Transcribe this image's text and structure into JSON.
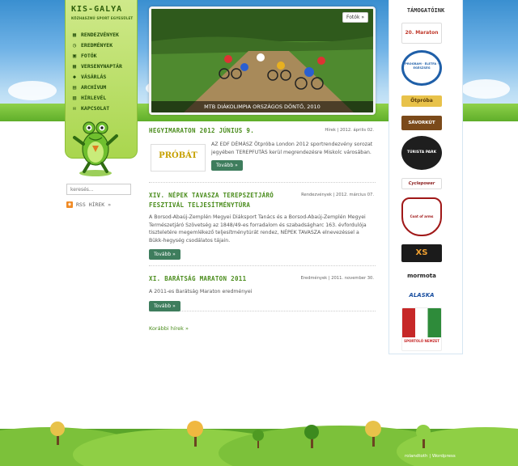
{
  "site": {
    "title": "KIS-GALYA",
    "subtitle": "KÖZHASZNÚ SPORT EGYESÜLET"
  },
  "nav": {
    "items": [
      {
        "label": "RENDEZVÉNYEK",
        "icon": "calendar-icon"
      },
      {
        "label": "EREDMÉNYEK",
        "icon": "clock-icon"
      },
      {
        "label": "FOTÓK",
        "icon": "photos-icon"
      },
      {
        "label": "VERSENYNAPTÁR",
        "icon": "calendar-icon"
      },
      {
        "label": "VÁSÁRLÁS",
        "icon": "tag-icon"
      },
      {
        "label": "ARCHÍVUM",
        "icon": "archive-icon"
      },
      {
        "label": "HÍRLEVÉL",
        "icon": "newsletter-icon"
      },
      {
        "label": "KAPCSOLAT",
        "icon": "mail-icon"
      }
    ]
  },
  "search": {
    "placeholder": "keresés..."
  },
  "rss": {
    "label": "RSS HÍREK »"
  },
  "slider": {
    "button": "Fotók »",
    "caption": "MTB DIÁKOLIMPIA ORSZÁGOS DÖNTŐ, 2010"
  },
  "posts": [
    {
      "title": "HEGYIMARATON 2012 JÚNIUS 9.",
      "meta": "Hírek | 2012. április 02.",
      "text": "AZ EDF DÉMÁSZ Ötpróba London 2012 sportrendezvény sorozat jegyében TEREPFUTÁS kerül megrendezésre Miskolc városában.",
      "image_text": "PRÓBÁT",
      "button": "Tovább »"
    },
    {
      "title": "XIV. NÉPEK TAVASZA TEREPSZETJÁRÓ FESZTIVÁL TELJESÍTMÉNYTÚRA",
      "meta": "Rendezvények | 2012. március 07.",
      "text": "A Borsod-Abaúj-Zemplén Megyei Diáksport Tanács és a Borsod-Abaúj-Zemplén Megyei Természetjáró Szövetség az 1848/49-es forradalom és szabadságharc 163. évfordulója tiszteletére megemlékező teljesítménytúrát rendez, NÉPEK TAVASZA elnevezéssel a Bükk-hegység csodálatos tájain.",
      "button": "Tovább »"
    },
    {
      "title": "XI. BARÁTSÁG MARATON 2011",
      "meta": "Eredmények | 2011. november 30.",
      "text": "A 2011-es Barátság Maraton eredményei",
      "button": "Tovább »"
    }
  ],
  "older": "Korábbi hírek »",
  "sponsors": {
    "title": "TÁMOGATÓINK",
    "items": [
      {
        "label": "20. Maraton",
        "color": "#c0392b"
      },
      {
        "label": "PROGRAM · ÉLETFA · EGÉSZSÉG",
        "color": "#1f5fa8"
      },
      {
        "label": "Ötpróba",
        "color": "#7a5a10"
      },
      {
        "label": "SÁVORKÚT",
        "color": "#7b4a1a"
      },
      {
        "label": "TÚRISTA PARK",
        "color": "#1e1e1e"
      },
      {
        "label": "Cyclepower",
        "color": "#8a1c1c"
      },
      {
        "label": "Coat of arms",
        "color": "#a01818"
      },
      {
        "label": "XS",
        "color": "#d4601a"
      },
      {
        "label": "mormota",
        "color": "#222"
      },
      {
        "label": "ALASKA",
        "color": "#1a4fa0"
      },
      {
        "label": "SPORTOLÓ NEMZET",
        "color": "#c62828"
      }
    ]
  },
  "footer": "rolandtoth | Wordpress"
}
